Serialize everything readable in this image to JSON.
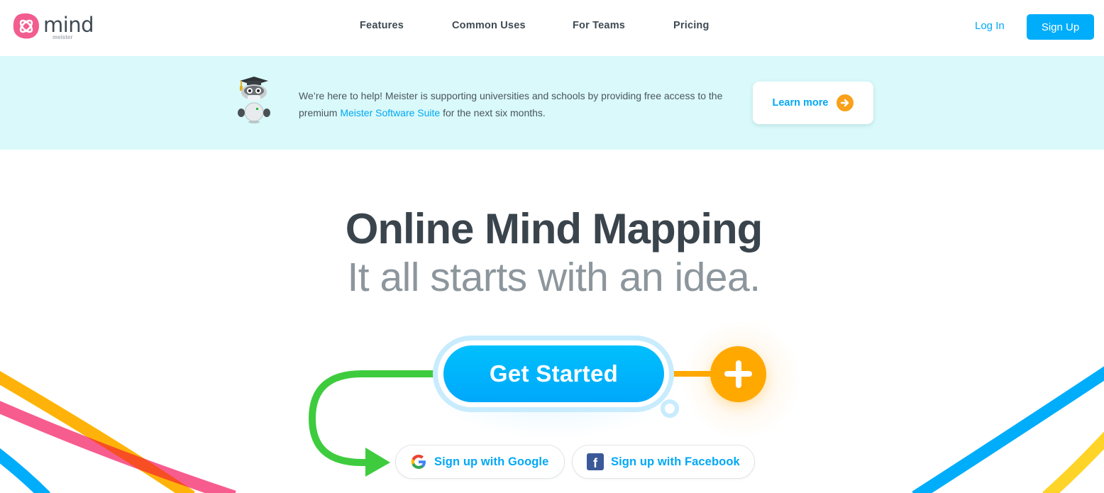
{
  "header": {
    "logo": {
      "word": "mind",
      "sub": "meister",
      "color": "#f25c8f"
    },
    "nav": [
      {
        "label": "Features"
      },
      {
        "label": "Common Uses"
      },
      {
        "label": "For Teams"
      },
      {
        "label": "Pricing"
      }
    ],
    "login_label": "Log In",
    "signup_label": "Sign Up"
  },
  "banner": {
    "text_before": "We’re here to help! Meister is supporting universities and schools by providing free access to the premium ",
    "link_text": "Meister Software Suite",
    "text_after": " for the next six months.",
    "button_label": "Learn more",
    "background": "#d9f9fa"
  },
  "hero": {
    "title": "Online Mind Mapping",
    "subtitle": "It all starts with an idea.",
    "cta_label": "Get Started",
    "google_label": "Sign up with Google",
    "facebook_label": "Sign up with Facebook",
    "facebook_glyph": "f"
  },
  "colors": {
    "accent": "#00adfa",
    "orange": "#ffa800",
    "green": "#3ecc3e",
    "yellow": "#ffd428",
    "pink": "#f75c8f",
    "red_overlap": "#f74b16",
    "text_dark": "#3a444c",
    "text_gray": "#8c969c"
  }
}
